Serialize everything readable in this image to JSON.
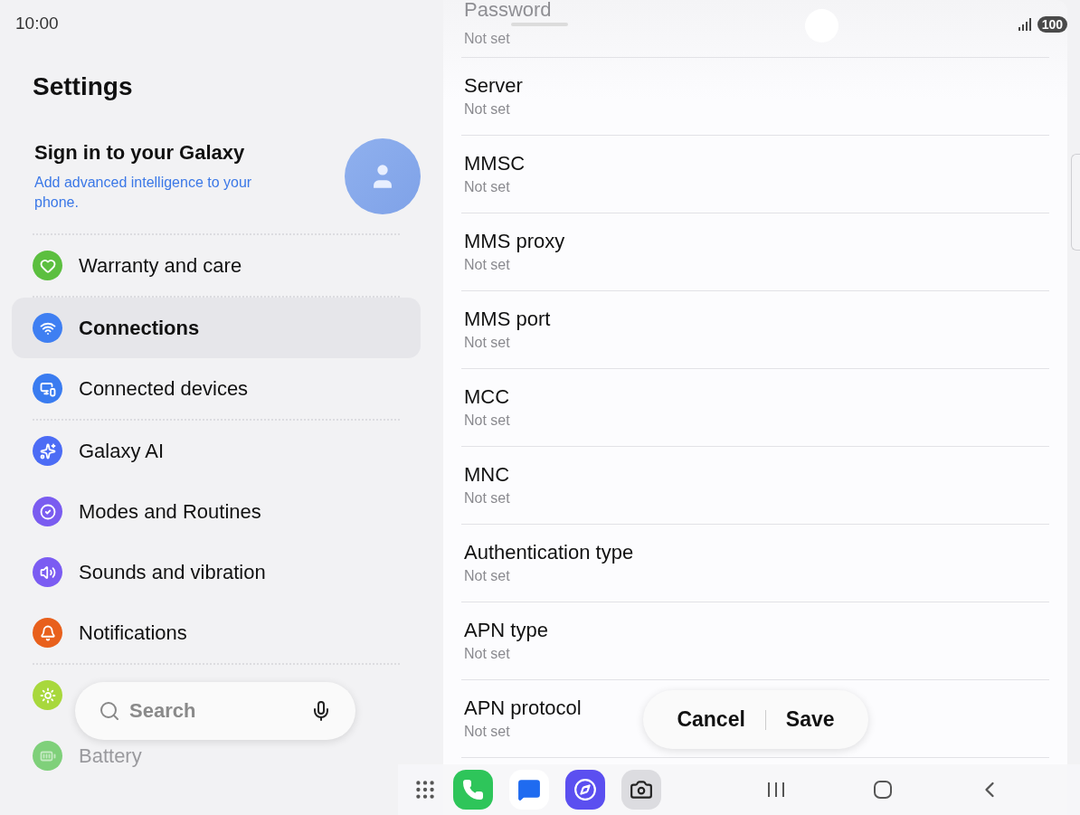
{
  "status_bar": {
    "time": "10:00",
    "battery": "100"
  },
  "sidebar": {
    "title": "Settings",
    "account": {
      "title": "Sign in to your Galaxy",
      "subtitle": "Add advanced intelligence to your phone."
    },
    "sections": [
      [
        {
          "label": "Warranty and care",
          "selected": false,
          "faded": false,
          "color": "#5cbf3f"
        }
      ],
      [
        {
          "label": "Connections",
          "selected": true,
          "faded": false,
          "color": "#3f7ff2"
        },
        {
          "label": "Connected devices",
          "selected": false,
          "faded": false,
          "color": "#3a7cf0"
        }
      ],
      [
        {
          "label": "Galaxy AI",
          "selected": false,
          "faded": false,
          "color": "#4c6cf5"
        },
        {
          "label": "Modes and Routines",
          "selected": false,
          "faded": false,
          "color": "#7a5cf0"
        },
        {
          "label": "Sounds and vibration",
          "selected": false,
          "faded": false,
          "color": "#7b5cf2"
        },
        {
          "label": "Notifications",
          "selected": false,
          "faded": false,
          "color": "#e8601c"
        }
      ],
      [
        {
          "selected": false,
          "faded": false,
          "color": "#a8d83c"
        },
        {
          "label": "Battery",
          "selected": false,
          "faded": true,
          "color": "#7fd07a"
        }
      ]
    ]
  },
  "search": {
    "placeholder": "Search"
  },
  "apn_fields": [
    {
      "label": "Password",
      "value": "Not set",
      "faded": true
    },
    {
      "label": "Server",
      "value": "Not set",
      "faded": false
    },
    {
      "label": "MMSC",
      "value": "Not set",
      "faded": false
    },
    {
      "label": "MMS proxy",
      "value": "Not set",
      "faded": false
    },
    {
      "label": "MMS port",
      "value": "Not set",
      "faded": false
    },
    {
      "label": "MCC",
      "value": "Not set",
      "faded": false
    },
    {
      "label": "MNC",
      "value": "Not set",
      "faded": false
    },
    {
      "label": "Authentication type",
      "value": "Not set",
      "faded": false
    },
    {
      "label": "APN type",
      "value": "Not set",
      "faded": false
    },
    {
      "label": "APN protocol",
      "value": "Not set",
      "faded": false
    }
  ],
  "action_bar": {
    "cancel": "Cancel",
    "save": "Save"
  }
}
